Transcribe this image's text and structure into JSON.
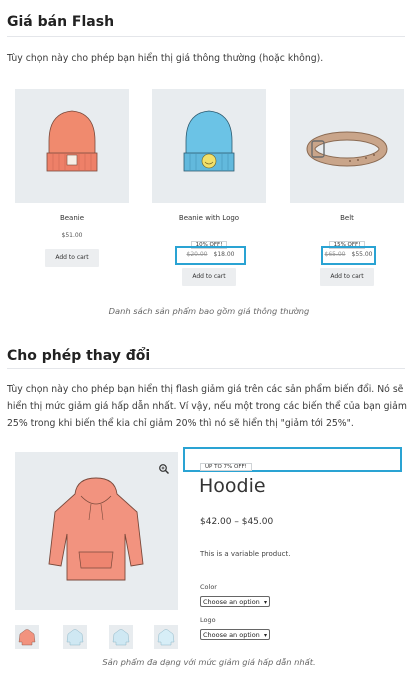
{
  "section1": {
    "title": "Giá bán Flash",
    "description": "Tùy chọn này cho phép bạn hiển thị giá thông thường (hoặc không).",
    "products": [
      {
        "name": "Beanie",
        "price": "$51.00",
        "button": "Add to cart",
        "icon": "beanie-hat-icon",
        "color": "#f08a6e"
      },
      {
        "name": "Beanie with Logo",
        "badge": "10% OFF!",
        "old_price": "$20.00",
        "new_price": "$18.00",
        "button": "Add to cart",
        "icon": "beanie-logo-hat-icon",
        "color": "#6bc3e6"
      },
      {
        "name": "Belt",
        "badge": "15% OFF!",
        "old_price": "$65.00",
        "new_price": "$55.00",
        "button": "Add to cart",
        "icon": "belt-icon",
        "color": "#c9a58a"
      }
    ],
    "caption": "Danh sách sản phẩm bao gồm giá thông thường"
  },
  "section2": {
    "title": "Cho phép thay đổi",
    "description_lines": [
      "Tùy chọn này cho phép bạn hiển thị flash giảm giá trên các sản phẩm biến đổi. Nó sẽ",
      "hiển thị mức giảm giá hấp dẫn nhất. Ví vậy, nếu một trong các biến thể của bạn giảm",
      "25% trong khi biến thể kia chỉ giảm 20% thì nó sẽ hiển thị \"giảm tới 25%\"."
    ],
    "product": {
      "badge": "UP TO 7% OFF!",
      "name": "Hoodie",
      "price_range": "$42.00 – $45.00",
      "short_description": "This is a variable product.",
      "attributes": [
        {
          "label": "Color",
          "select_value": "Choose an option"
        },
        {
          "label": "Logo",
          "select_value": "Choose an option"
        }
      ],
      "zoom_icon": "magnifier-icon",
      "main_image_icon": "hoodie-icon",
      "gallery_icons": [
        "hoodie-thumb-icon",
        "hoodie-thumb-icon",
        "hoodie-thumb-icon",
        "hoodie-thumb-icon"
      ]
    },
    "caption": "Sản phẩm đa dạng với mức giảm giá hấp dẫn nhất."
  },
  "colors": {
    "highlight": "#2aa3d3",
    "thumb_bg": "#e8ecef",
    "button_bg": "#eceef0"
  }
}
